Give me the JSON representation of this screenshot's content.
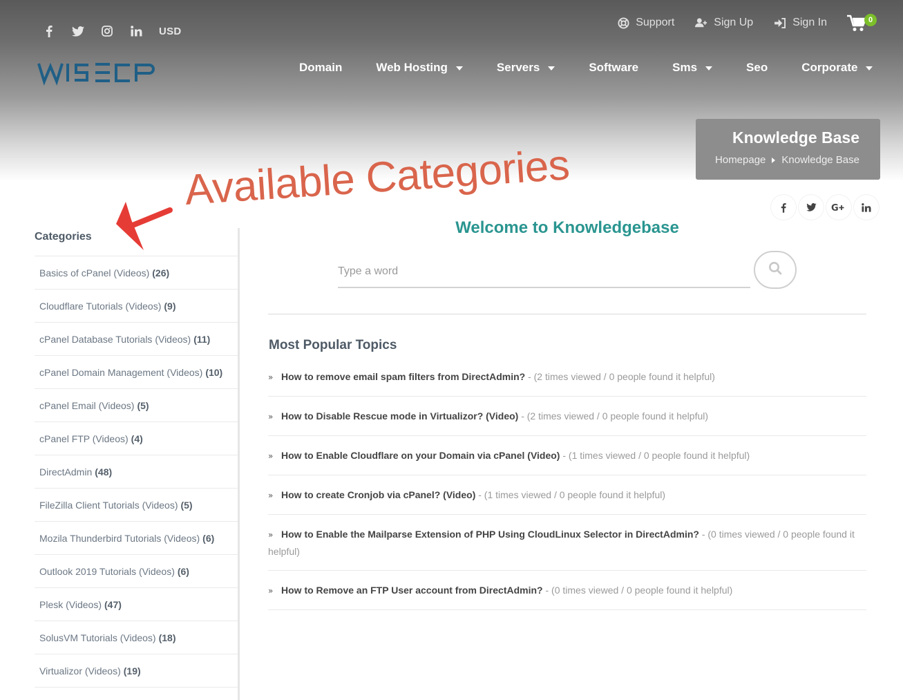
{
  "header": {
    "social": [
      "facebook-icon",
      "twitter-icon",
      "instagram-icon",
      "linkedin-icon"
    ],
    "currency": "USD",
    "links": [
      {
        "label": "Support",
        "icon": "lifebuoy-icon"
      },
      {
        "label": "Sign Up",
        "icon": "user-plus-icon"
      },
      {
        "label": "Sign In",
        "icon": "sign-in-icon"
      }
    ],
    "cart_count": "0",
    "logo_text": "WISECP"
  },
  "nav": {
    "items": [
      {
        "label": "Domain",
        "dropdown": false
      },
      {
        "label": "Web Hosting",
        "dropdown": true
      },
      {
        "label": "Servers",
        "dropdown": true
      },
      {
        "label": "Software",
        "dropdown": false
      },
      {
        "label": "Sms",
        "dropdown": true
      },
      {
        "label": "Seo",
        "dropdown": false
      },
      {
        "label": "Corporate",
        "dropdown": true
      }
    ]
  },
  "page_header": {
    "title": "Knowledge Base",
    "breadcrumb": [
      "Homepage",
      "Knowledge Base"
    ]
  },
  "annotation": "Available Categories",
  "share": [
    "facebook-icon",
    "twitter-icon",
    "google-plus-icon",
    "linkedin-icon"
  ],
  "sidebar": {
    "title": "Categories",
    "categories": [
      {
        "name": "Basics of cPanel (Videos)",
        "count": "(26)"
      },
      {
        "name": "Cloudflare Tutorials (Videos)",
        "count": "(9)"
      },
      {
        "name": "cPanel Database Tutorials (Videos)",
        "count": "(11)"
      },
      {
        "name": "cPanel Domain Management (Videos)",
        "count": "(10)"
      },
      {
        "name": "cPanel Email (Videos)",
        "count": "(5)"
      },
      {
        "name": "cPanel FTP (Videos)",
        "count": "(4)"
      },
      {
        "name": "DirectAdmin",
        "count": "(48)"
      },
      {
        "name": "FileZilla Client Tutorials (Videos)",
        "count": "(5)"
      },
      {
        "name": "Mozila Thunderbird Tutorials (Videos)",
        "count": "(6)"
      },
      {
        "name": "Outlook 2019 Tutorials (Videos)",
        "count": "(6)"
      },
      {
        "name": "Plesk (Videos)",
        "count": "(47)"
      },
      {
        "name": "SolusVM Tutorials (Videos)",
        "count": "(18)"
      },
      {
        "name": "Virtualizor (Videos)",
        "count": "(19)"
      }
    ]
  },
  "main": {
    "welcome": "Welcome to Knowledgebase",
    "search_placeholder": "Type a word",
    "popular_title": "Most Popular Topics",
    "topics": [
      {
        "title": "How to remove email spam filters from DirectAdmin?",
        "meta": " - (2 times viewed / 0 people found it helpful)"
      },
      {
        "title": "How to Disable Rescue mode in Virtualizor? (Video)",
        "meta": " - (2 times viewed / 0 people found it helpful)"
      },
      {
        "title": "How to Enable Cloudflare on your Domain via cPanel (Video)",
        "meta": " - (1 times viewed / 0 people found it helpful)"
      },
      {
        "title": "How to create Cronjob via cPanel? (Video)",
        "meta": " - (1 times viewed / 0 people found it helpful)"
      },
      {
        "title": "How to Enable the Mailparse Extension of PHP Using CloudLinux Selector in DirectAdmin?",
        "meta": " - (0 times viewed / 0 people found it helpful)"
      },
      {
        "title": "How to Remove an FTP User account from DirectAdmin?",
        "meta": " - (0 times viewed / 0 people found it helpful)"
      }
    ]
  },
  "colors": {
    "accent": "#2a9590",
    "logo": "#1f5f86",
    "annotation": "#d9654c",
    "cart_badge": "#7cbf2a"
  }
}
